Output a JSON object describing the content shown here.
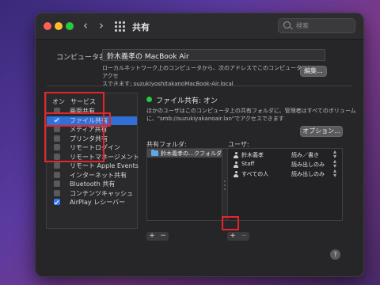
{
  "window": {
    "title": "共有",
    "search_placeholder": "検索"
  },
  "computer_name": {
    "label": "コンピュータ名:",
    "value": "鈴木義孝の MacBook Air",
    "description_line1": "ローカルネットワーク上のコンピュータから、次のアドレスでこのコンピュータにアクセ",
    "description_line2": "スできます: suzukiyoshitakanoMacBook-Air.local",
    "edit_button": "編集..."
  },
  "services": {
    "header_on": "オン",
    "header_service": "サービス",
    "items": [
      {
        "label": "画面共有",
        "checked": false,
        "selected": false
      },
      {
        "label": "ファイル共有",
        "checked": true,
        "selected": true
      },
      {
        "label": "メディア共有",
        "checked": false,
        "selected": false
      },
      {
        "label": "プリンタ共有",
        "checked": false,
        "selected": false
      },
      {
        "label": "リモートログイン",
        "checked": false,
        "selected": false
      },
      {
        "label": "リモートマネージメント",
        "checked": false,
        "selected": false
      },
      {
        "label": "リモート Apple Events",
        "checked": false,
        "selected": false
      },
      {
        "label": "インターネット共有",
        "checked": false,
        "selected": false
      },
      {
        "label": "Bluetooth 共有",
        "checked": false,
        "selected": false
      },
      {
        "label": "コンテンツキャッシュ",
        "checked": false,
        "selected": false
      },
      {
        "label": "AirPlay レシーバー",
        "checked": true,
        "selected": false
      }
    ]
  },
  "file_sharing": {
    "status": "ファイル共有: オン",
    "status_color": "#28c840",
    "description_line1": "ほかのユーザはこのコンピュータ上の共有フォルダに、管理者はすべてのボリューム",
    "description_line2": "に、\"smb://suzukiyakanoair.lan\"でアクセスできます",
    "options_button": "オプション...",
    "folders_label": "共有フォルダ:",
    "folders": [
      "鈴木義孝の…クフォルダ"
    ],
    "users_label": "ユーザ:",
    "users": [
      {
        "name": "鈴木義孝",
        "permission": "読み／書き"
      },
      {
        "name": "Staff",
        "permission": "読み出しのみ"
      },
      {
        "name": "すべての人",
        "permission": "読み出しのみ"
      }
    ]
  },
  "controls": {
    "add": "+",
    "remove": "−",
    "help": "?"
  },
  "colors": {
    "accent": "#2f6fd6",
    "highlight_box": "#e3262b"
  }
}
